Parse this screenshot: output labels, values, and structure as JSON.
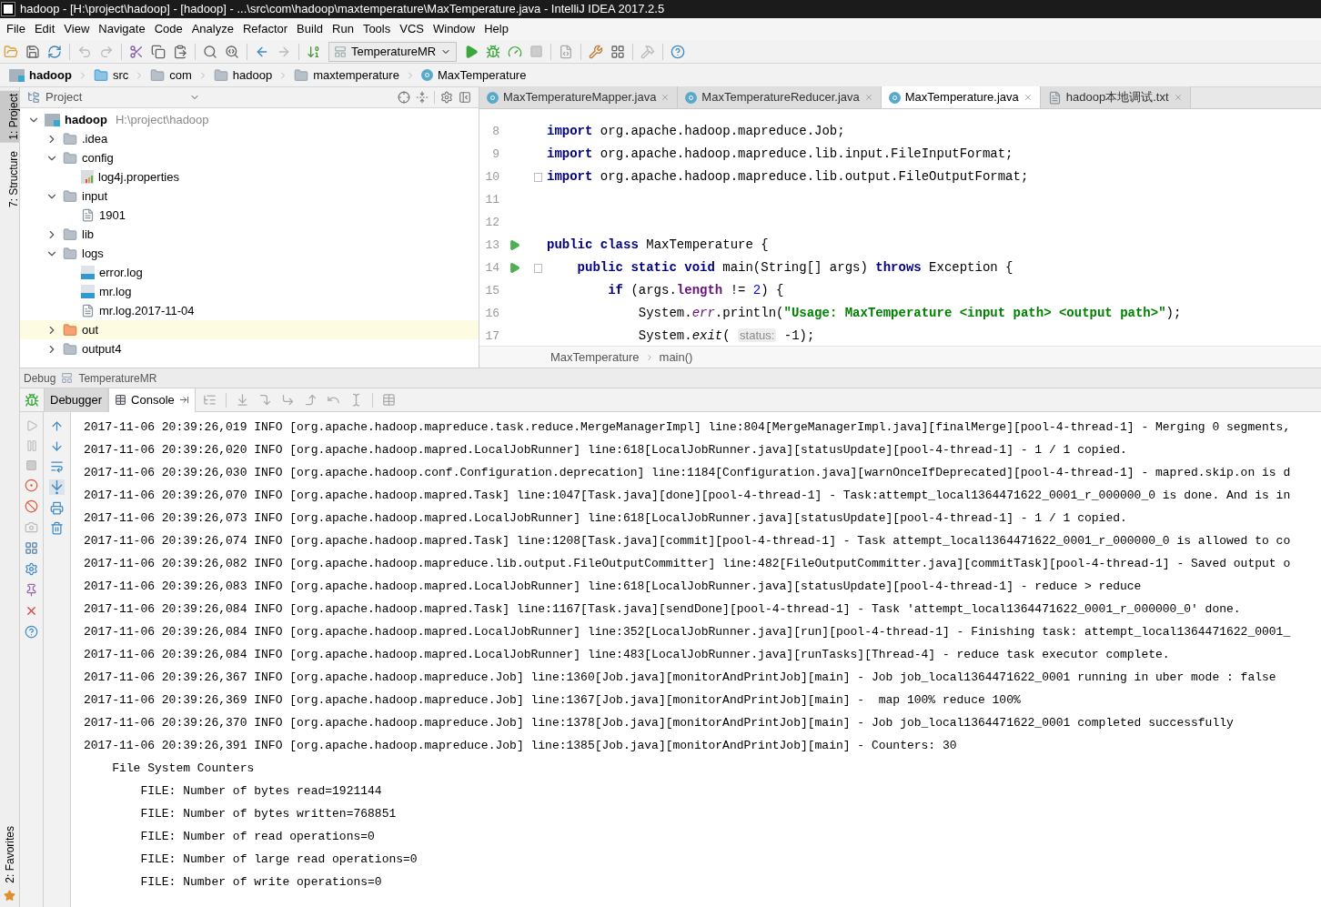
{
  "window": {
    "title": "hadoop - [H:\\project\\hadoop] - [hadoop] - ...\\src\\com\\hadoop\\maxtemperature\\MaxTemperature.java - IntelliJ IDEA 2017.2.5"
  },
  "menu": [
    "File",
    "Edit",
    "View",
    "Navigate",
    "Code",
    "Analyze",
    "Refactor",
    "Build",
    "Run",
    "Tools",
    "VCS",
    "Window",
    "Help"
  ],
  "toolbar": {
    "run_config": "TemperatureMR"
  },
  "breadcrumbs": [
    {
      "label": "hadoop",
      "kind": "module"
    },
    {
      "label": "src",
      "kind": "source"
    },
    {
      "label": "com",
      "kind": "folder"
    },
    {
      "label": "hadoop",
      "kind": "folder"
    },
    {
      "label": "maxtemperature",
      "kind": "folder"
    },
    {
      "label": "MaxTemperature",
      "kind": "class"
    }
  ],
  "side_tools": {
    "top": [
      {
        "label": "1: Project",
        "selected": true
      },
      {
        "label": "7: Structure",
        "selected": false
      }
    ],
    "bottom": [
      {
        "label": "2: Favorites",
        "selected": false
      }
    ]
  },
  "project_panel": {
    "title": "Project",
    "tree": [
      {
        "label": "hadoop",
        "path": "H:\\project\\hadoop",
        "kind": "module",
        "expanded": true,
        "highlighted": false,
        "children": [
          {
            "label": ".idea",
            "kind": "folder",
            "expanded": false,
            "highlighted": false
          },
          {
            "label": "config",
            "kind": "folder",
            "expanded": true,
            "highlighted": false,
            "children": [
              {
                "label": "log4j.properties",
                "kind": "properties",
                "highlighted": false
              }
            ]
          },
          {
            "label": "input",
            "kind": "folder",
            "expanded": true,
            "highlighted": false,
            "children": [
              {
                "label": "1901",
                "kind": "text",
                "highlighted": false
              }
            ]
          },
          {
            "label": "lib",
            "kind": "folder",
            "expanded": false,
            "highlighted": false
          },
          {
            "label": "logs",
            "kind": "folder",
            "expanded": true,
            "highlighted": false,
            "children": [
              {
                "label": "error.log",
                "kind": "log",
                "highlighted": false
              },
              {
                "label": "mr.log",
                "kind": "log",
                "highlighted": false
              },
              {
                "label": "mr.log.2017-11-04",
                "kind": "text",
                "highlighted": false
              }
            ]
          },
          {
            "label": "out",
            "kind": "excluded",
            "expanded": false,
            "highlighted": true
          },
          {
            "label": "output4",
            "kind": "folder",
            "expanded": false,
            "highlighted": false
          }
        ]
      }
    ]
  },
  "editor": {
    "tabs": [
      {
        "label": "MaxTemperatureMapper.java",
        "kind": "class",
        "selected": false
      },
      {
        "label": "MaxTemperatureReducer.java",
        "kind": "class",
        "selected": false
      },
      {
        "label": "MaxTemperature.java",
        "kind": "class",
        "selected": true
      },
      {
        "label": "hadoop本地调试.txt",
        "kind": "text",
        "selected": false
      }
    ],
    "lines": [
      {
        "number": "8",
        "run": false,
        "fold": false,
        "segments": [
          {
            "kind": "kw",
            "text": "import"
          },
          {
            "kind": "plain",
            "text": " org.apache.hadoop.mapreduce.Job;"
          }
        ]
      },
      {
        "number": "9",
        "run": false,
        "fold": false,
        "segments": [
          {
            "kind": "kw",
            "text": "import"
          },
          {
            "kind": "plain",
            "text": " org.apache.hadoop.mapreduce.lib.input.FileInputFormat;"
          }
        ]
      },
      {
        "number": "10",
        "run": false,
        "fold": true,
        "segments": [
          {
            "kind": "kw",
            "text": "import"
          },
          {
            "kind": "plain",
            "text": " org.apache.hadoop.mapreduce.lib.output.FileOutputFormat;"
          }
        ]
      },
      {
        "number": "11",
        "run": false,
        "fold": false
      },
      {
        "number": "12",
        "run": false,
        "fold": false
      },
      {
        "number": "13",
        "run": true,
        "fold": false,
        "segments": [
          {
            "kind": "kw",
            "text": "public class"
          },
          {
            "kind": "plain",
            "text": " MaxTemperature {"
          }
        ]
      },
      {
        "number": "14",
        "run": true,
        "fold": true,
        "segments": [
          {
            "kind": "kw",
            "text": "    public static void"
          },
          {
            "kind": "plain",
            "text": " main(String[] args) "
          },
          {
            "kind": "kw",
            "text": "throws"
          },
          {
            "kind": "plain",
            "text": " Exception {"
          }
        ]
      },
      {
        "number": "15",
        "run": false,
        "fold": false,
        "segments": [
          {
            "kind": "kw",
            "text": "        if"
          },
          {
            "kind": "plain",
            "text": " (args."
          },
          {
            "kind": "field",
            "text": "length"
          },
          {
            "kind": "plain",
            "text": " != "
          },
          {
            "kind": "num",
            "text": "2"
          },
          {
            "kind": "plain",
            "text": ") {"
          }
        ]
      },
      {
        "number": "16",
        "run": false,
        "fold": false,
        "segments": [
          {
            "kind": "plain",
            "text": "            System."
          },
          {
            "kind": "static",
            "text": "err"
          },
          {
            "kind": "plain",
            "text": ".println("
          },
          {
            "kind": "string",
            "text": "\"Usage: MaxTemperature <input path> <output path>\""
          },
          {
            "kind": "plain",
            "text": ");"
          }
        ]
      },
      {
        "number": "17",
        "run": false,
        "fold": false,
        "segments": [
          {
            "kind": "plain",
            "text": "            System."
          },
          {
            "kind": "method",
            "text": "exit"
          },
          {
            "kind": "plain",
            "text": "( "
          },
          {
            "kind": "hint",
            "text": "status:"
          },
          {
            "kind": "plain",
            "text": " -1);"
          }
        ]
      }
    ],
    "breadcrumb": [
      "MaxTemperature",
      "main()"
    ]
  },
  "debug": {
    "title": "Debug",
    "config": "TemperatureMR",
    "tabs": [
      {
        "label": "Debugger",
        "selected": false
      },
      {
        "label": "Console",
        "selected": true
      }
    ],
    "console": [
      "2017-11-06 20:39:26,019 INFO [org.apache.hadoop.mapreduce.task.reduce.MergeManagerImpl] line:804[MergeManagerImpl.java][finalMerge][pool-4-thread-1] - Merging 0 segments,",
      "2017-11-06 20:39:26,020 INFO [org.apache.hadoop.mapred.LocalJobRunner] line:618[LocalJobRunner.java][statusUpdate][pool-4-thread-1] - 1 / 1 copied.",
      "2017-11-06 20:39:26,030 INFO [org.apache.hadoop.conf.Configuration.deprecation] line:1184[Configuration.java][warnOnceIfDeprecated][pool-4-thread-1] - mapred.skip.on is d",
      "2017-11-06 20:39:26,070 INFO [org.apache.hadoop.mapred.Task] line:1047[Task.java][done][pool-4-thread-1] - Task:attempt_local1364471622_0001_r_000000_0 is done. And is in",
      "2017-11-06 20:39:26,073 INFO [org.apache.hadoop.mapred.LocalJobRunner] line:618[LocalJobRunner.java][statusUpdate][pool-4-thread-1] - 1 / 1 copied.",
      "2017-11-06 20:39:26,074 INFO [org.apache.hadoop.mapred.Task] line:1208[Task.java][commit][pool-4-thread-1] - Task attempt_local1364471622_0001_r_000000_0 is allowed to co",
      "2017-11-06 20:39:26,082 INFO [org.apache.hadoop.mapreduce.lib.output.FileOutputCommitter] line:482[FileOutputCommitter.java][commitTask][pool-4-thread-1] - Saved output o",
      "2017-11-06 20:39:26,083 INFO [org.apache.hadoop.mapred.LocalJobRunner] line:618[LocalJobRunner.java][statusUpdate][pool-4-thread-1] - reduce > reduce",
      "2017-11-06 20:39:26,084 INFO [org.apache.hadoop.mapred.Task] line:1167[Task.java][sendDone][pool-4-thread-1] - Task 'attempt_local1364471622_0001_r_000000_0' done.",
      "2017-11-06 20:39:26,084 INFO [org.apache.hadoop.mapred.LocalJobRunner] line:352[LocalJobRunner.java][run][pool-4-thread-1] - Finishing task: attempt_local1364471622_0001_",
      "2017-11-06 20:39:26,084 INFO [org.apache.hadoop.mapred.LocalJobRunner] line:483[LocalJobRunner.java][runTasks][Thread-4] - reduce task executor complete.",
      "2017-11-06 20:39:26,367 INFO [org.apache.hadoop.mapreduce.Job] line:1360[Job.java][monitorAndPrintJob][main] - Job job_local1364471622_0001 running in uber mode : false",
      "2017-11-06 20:39:26,369 INFO [org.apache.hadoop.mapreduce.Job] line:1367[Job.java][monitorAndPrintJob][main] -  map 100% reduce 100%",
      "2017-11-06 20:39:26,370 INFO [org.apache.hadoop.mapreduce.Job] line:1378[Job.java][monitorAndPrintJob][main] - Job job_local1364471622_0001 completed successfully",
      "2017-11-06 20:39:26,391 INFO [org.apache.hadoop.mapreduce.Job] line:1385[Job.java][monitorAndPrintJob][main] - Counters: 30",
      "    File System Counters",
      "        FILE: Number of bytes read=1921144",
      "        FILE: Number of bytes written=768851",
      "        FILE: Number of read operations=0",
      "        FILE: Number of large read operations=0",
      "        FILE: Number of write operations=0"
    ]
  }
}
